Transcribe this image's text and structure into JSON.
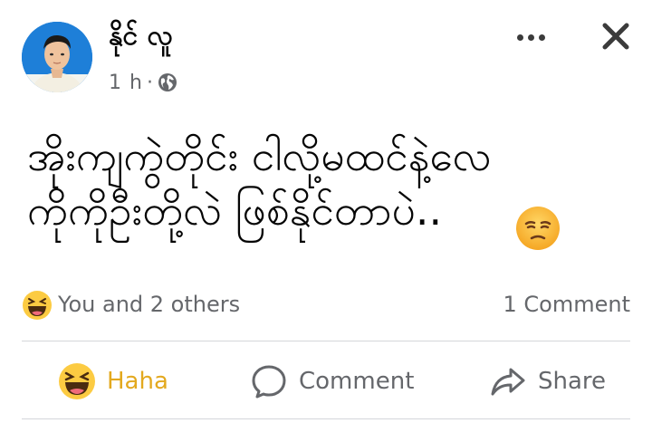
{
  "post": {
    "author": "နိုင် လူ",
    "time": "1 h",
    "separator": "·",
    "privacy_icon": "globe-icon",
    "text_lines": "အိုးကျကွဲတိုင်း ငါလို့မထင်နဲ့လေ\nကိုကိုဦးတို့လဲ ဖြစ်နိုင်တာပဲ..",
    "emoji": "confused-face-emoji"
  },
  "header": {
    "more_icon": "more-horizontal-icon",
    "close_icon": "close-icon"
  },
  "stats": {
    "reaction_icon": "haha-emoji-icon",
    "reaction_summary": "You and 2 others",
    "comments": "1 Comment"
  },
  "actions": {
    "haha_label": "Haha",
    "comment_label": "Comment",
    "share_label": "Share"
  },
  "colors": {
    "haha_accent": "#e3a91f",
    "secondary_text": "#65676b",
    "avatar_bg": "#1e7fd8"
  }
}
